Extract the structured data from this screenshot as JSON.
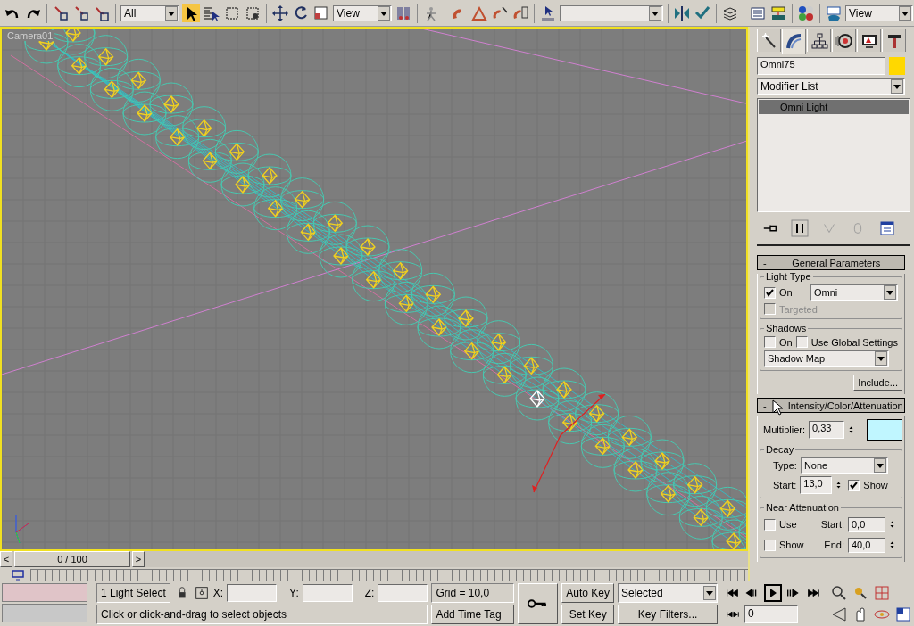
{
  "toolbar": {
    "selection_filter": "All",
    "reference_coord": "View",
    "render_view": "View"
  },
  "viewport": {
    "label": "Camera01"
  },
  "command_panel": {
    "tabs": [
      {
        "kind": "create",
        "selected": false
      },
      {
        "kind": "modify",
        "selected": true
      },
      {
        "kind": "hierarchy",
        "selected": false
      },
      {
        "kind": "motion",
        "selected": false
      },
      {
        "kind": "display",
        "selected": false
      },
      {
        "kind": "utilities",
        "selected": false
      }
    ],
    "object_name": "Omni75",
    "modifier_list": "Modifier List",
    "stack": [
      {
        "label": "Omni Light",
        "selected": true
      }
    ],
    "general_parameters": {
      "sign": "-",
      "title": "General Parameters",
      "light_type": {
        "title": "Light Type",
        "on": {
          "label": "On",
          "checked": true
        },
        "type": "Omni",
        "targeted": {
          "label": "Targeted",
          "checked": false,
          "disabled": true
        }
      },
      "shadows": {
        "title": "Shadows",
        "on": {
          "label": "On",
          "checked": false
        },
        "use_global": {
          "label": "Use Global Settings",
          "checked": false
        },
        "type": "Shadow Map",
        "include_button": "Include..."
      }
    },
    "intensity": {
      "sign": "-",
      "title": "Intensity/Color/Attenuation",
      "multiplier_label": "Multiplier:",
      "multiplier": "0,33",
      "decay": {
        "title": "Decay",
        "type_label": "Type:",
        "type": "None",
        "start_label": "Start:",
        "start": "13,0",
        "show": {
          "label": "Show",
          "checked": true
        }
      },
      "near_attenuation": {
        "title": "Near Attenuation",
        "use": {
          "label": "Use",
          "checked": false
        },
        "show": {
          "label": "Show",
          "checked": false
        },
        "start_label": "Start:",
        "start": "0,0",
        "end_label": "End:",
        "end": "40,0"
      }
    }
  },
  "time_slider": {
    "prev": "<",
    "position": "0 / 100",
    "next": ">"
  },
  "status": {
    "selection": "1 Light Select",
    "x_label": "X:",
    "y_label": "Y:",
    "z_label": "Z:",
    "grid": "Grid = 10,0",
    "prompt": "Click or click-and-drag to select objects",
    "add_time_tag": "Add Time Tag"
  },
  "animation": {
    "auto_key": "Auto Key",
    "set_key": "Set Key",
    "key_mode": "Selected",
    "key_filters": "Key Filters...",
    "frame": "0"
  }
}
